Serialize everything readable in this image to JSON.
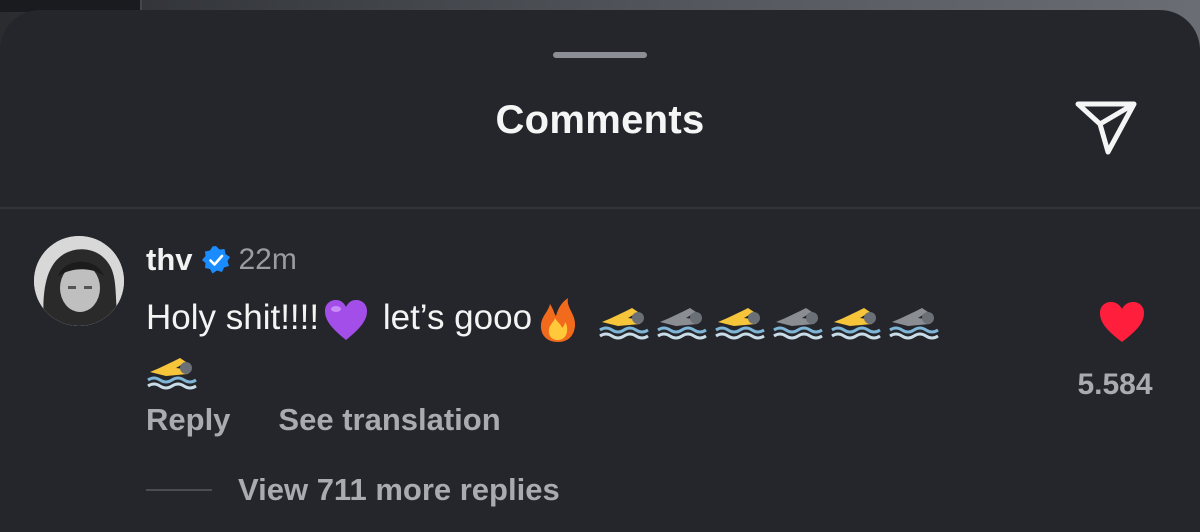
{
  "header": {
    "title": "Comments",
    "send_icon": "paper-plane-icon"
  },
  "comment": {
    "username": "thv",
    "verified_icon": "verified-badge-icon",
    "time": "22m",
    "text_part1": "Holy shit!!!!",
    "text_part2": " let’s gooo",
    "emojis": [
      "purple-heart-emoji",
      "fire-emoji",
      "swimmer-emoji"
    ],
    "swimmer_count": 7,
    "like_icon": "heart-icon",
    "like_count": "5.584",
    "reply_label": "Reply",
    "translate_label": "See translation",
    "view_replies_label": "View 711 more replies"
  },
  "colors": {
    "sheet_bg": "#25262b",
    "like_red": "#ff1f3d",
    "verified_blue": "#1a8cff",
    "muted_text": "#a9abb0"
  }
}
